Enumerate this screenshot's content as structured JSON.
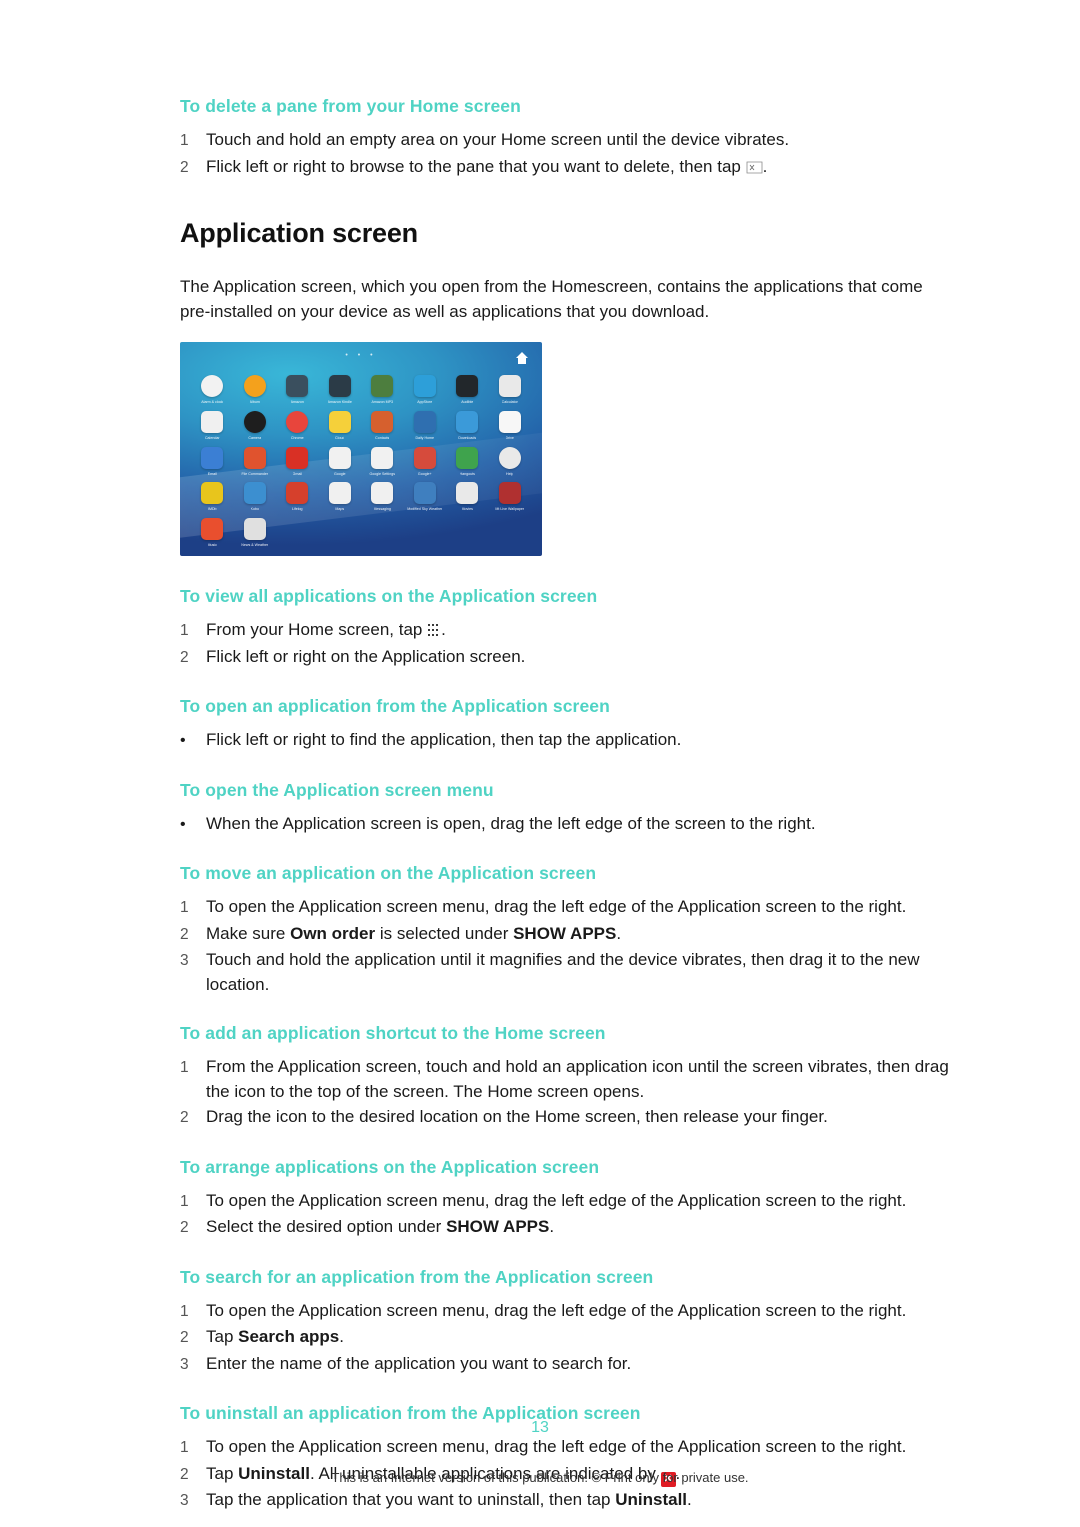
{
  "document": {
    "page_number": "13",
    "footer": "This is an Internet version of this publication. © Print only for private use."
  },
  "sections": [
    {
      "heading": "To delete a pane from your Home screen",
      "items": [
        {
          "marker": "1",
          "text": "Touch and hold an empty area on your Home screen until the device vibrates."
        },
        {
          "marker": "2",
          "text": "Flick left or right to browse to the pane that you want to delete, then tap "
        }
      ]
    }
  ],
  "main_heading": "Application screen",
  "intro_paragraph": "The Application screen, which you open from the Homescreen, contains the applications that come pre-installed on your device as well as applications that you download.",
  "screenshot": {
    "alt": "Application screen showing a grid of app icons on a blue background",
    "status_dots": "• • •",
    "apps": [
      {
        "label": "Alarm & clock",
        "color": "#f2f2f2",
        "shape": "circle"
      },
      {
        "label": "Album",
        "color": "#f4a11c",
        "shape": "circle"
      },
      {
        "label": "Amazon",
        "color": "#3a4f5e",
        "shape": "rounded"
      },
      {
        "label": "Amazon Kindle",
        "color": "#2b3b47",
        "shape": "rounded"
      },
      {
        "label": "Amazon MP3",
        "color": "#4d7e3e",
        "shape": "rounded"
      },
      {
        "label": "AppStore",
        "color": "#2d9fd9",
        "shape": "rounded"
      },
      {
        "label": "Audible",
        "color": "#22272b",
        "shape": "rounded"
      },
      {
        "label": "Calculator",
        "color": "#e9e9e9",
        "shape": "rounded"
      },
      {
        "label": "Calendar",
        "color": "#f0f0f0",
        "shape": "rounded"
      },
      {
        "label": "Camera",
        "color": "#1e1e1e",
        "shape": "circle"
      },
      {
        "label": "Chrome",
        "color": "#e8453c",
        "shape": "circle"
      },
      {
        "label": "Cloud",
        "color": "#f5d03a",
        "shape": "rounded"
      },
      {
        "label": "Contacts",
        "color": "#d6602e",
        "shape": "rounded"
      },
      {
        "label": "Daily Home",
        "color": "#2f6fb0",
        "shape": "rounded"
      },
      {
        "label": "Downloads",
        "color": "#3b9ad9",
        "shape": "rounded"
      },
      {
        "label": "Drive",
        "color": "#f7f7f7",
        "shape": "rounded"
      },
      {
        "label": "Email",
        "color": "#3b7fd4",
        "shape": "rounded"
      },
      {
        "label": "File Commander",
        "color": "#e0532e",
        "shape": "rounded"
      },
      {
        "label": "Gmail",
        "color": "#d93025",
        "shape": "rounded"
      },
      {
        "label": "Google",
        "color": "#f1f1f1",
        "shape": "rounded"
      },
      {
        "label": "Google Settings",
        "color": "#f1f1f1",
        "shape": "rounded"
      },
      {
        "label": "Google+",
        "color": "#d64b3c",
        "shape": "rounded"
      },
      {
        "label": "Hangouts",
        "color": "#3fa34d",
        "shape": "rounded"
      },
      {
        "label": "Help",
        "color": "#e9e9e9",
        "shape": "circle"
      },
      {
        "label": "IMDb",
        "color": "#e8c51c",
        "shape": "rounded"
      },
      {
        "label": "Kobo",
        "color": "#3c8fd0",
        "shape": "rounded"
      },
      {
        "label": "Lifelog",
        "color": "#d6402c",
        "shape": "rounded"
      },
      {
        "label": "Maps",
        "color": "#f0f0f0",
        "shape": "rounded"
      },
      {
        "label": "Messaging",
        "color": "#f0f0f0",
        "shape": "rounded"
      },
      {
        "label": "Modified Sky Weather",
        "color": "#3f7fbf",
        "shape": "rounded"
      },
      {
        "label": "Movies",
        "color": "#e9e9e9",
        "shape": "rounded"
      },
      {
        "label": "Mt Live Wallpaper",
        "color": "#b03030",
        "shape": "rounded"
      },
      {
        "label": "Music",
        "color": "#e94f2e",
        "shape": "rounded"
      },
      {
        "label": "News & Weather",
        "color": "#e0e0e0",
        "shape": "rounded"
      }
    ]
  },
  "procedures": [
    {
      "id": "view-all-applications",
      "heading": "To view all applications on the Application screen",
      "items": [
        {
          "marker": "1",
          "text_before": "From your Home screen, tap ",
          "icon": "apps-grid-icon",
          "text_after": "."
        },
        {
          "marker": "2",
          "text": "Flick left or right on the Application screen."
        }
      ]
    },
    {
      "id": "open-application",
      "heading": "To open an application from the Application screen",
      "items": [
        {
          "marker": "•",
          "text": "Flick left or right to find the application, then tap the application."
        }
      ]
    },
    {
      "id": "open-application-screen-menu",
      "heading": "To open the Application screen menu",
      "items": [
        {
          "marker": "•",
          "text": "When the Application screen is open, drag the left edge of the screen to the right."
        }
      ]
    },
    {
      "id": "move-application",
      "heading": "To move an application on the Application screen",
      "items": [
        {
          "marker": "1",
          "text": "To open the Application screen menu, drag the left edge of the Application screen to the right."
        },
        {
          "marker": "2",
          "parts": [
            {
              "t": "Make sure ",
              "b": false
            },
            {
              "t": "Own order",
              "b": true
            },
            {
              "t": " is selected under ",
              "b": false
            },
            {
              "t": "SHOW APPS",
              "b": true
            },
            {
              "t": ".",
              "b": false
            }
          ]
        },
        {
          "marker": "3",
          "text": "Touch and hold the application until it magnifies and the device vibrates, then drag it to the new location."
        }
      ]
    },
    {
      "id": "add-shortcut",
      "heading": "To add an application shortcut to the Home screen",
      "items": [
        {
          "marker": "1",
          "text": "From the Application screen, touch and hold an application icon until the screen vibrates, then drag the icon to the top of the screen. The Home screen opens."
        },
        {
          "marker": "2",
          "text": "Drag the icon to the desired location on the Home screen, then release your finger."
        }
      ]
    },
    {
      "id": "arrange-applications",
      "heading": "To arrange applications on the Application screen",
      "items": [
        {
          "marker": "1",
          "text": "To open the Application screen menu, drag the left edge of the Application screen to the right."
        },
        {
          "marker": "2",
          "parts": [
            {
              "t": "Select the desired option under ",
              "b": false
            },
            {
              "t": "SHOW APPS",
              "b": true
            },
            {
              "t": ".",
              "b": false
            }
          ]
        }
      ]
    },
    {
      "id": "search-application",
      "heading": "To search for an application from the Application screen",
      "items": [
        {
          "marker": "1",
          "text": "To open the Application screen menu, drag the left edge of the Application screen to the right."
        },
        {
          "marker": "2",
          "parts": [
            {
              "t": "Tap ",
              "b": false
            },
            {
              "t": "Search apps",
              "b": true
            },
            {
              "t": ".",
              "b": false
            }
          ]
        },
        {
          "marker": "3",
          "text": "Enter the name of the application you want to search for."
        }
      ]
    },
    {
      "id": "uninstall-application",
      "heading": "To uninstall an application from the Application screen",
      "items": [
        {
          "marker": "1",
          "text": "To open the Application screen menu, drag the left edge of the Application screen to the right."
        },
        {
          "marker": "2",
          "parts": [
            {
              "t": "Tap ",
              "b": false
            },
            {
              "t": "Uninstall",
              "b": true
            },
            {
              "t": ". All uninstallable applications are indicated by ",
              "b": false
            }
          ],
          "trailing_icon": "uninstall-x-badge-icon",
          "trailing_text": "."
        },
        {
          "marker": "3",
          "parts": [
            {
              "t": "Tap the application that you want to uninstall, then tap ",
              "b": false
            },
            {
              "t": "Uninstall",
              "b": true
            },
            {
              "t": ".",
              "b": false
            }
          ]
        }
      ]
    }
  ]
}
